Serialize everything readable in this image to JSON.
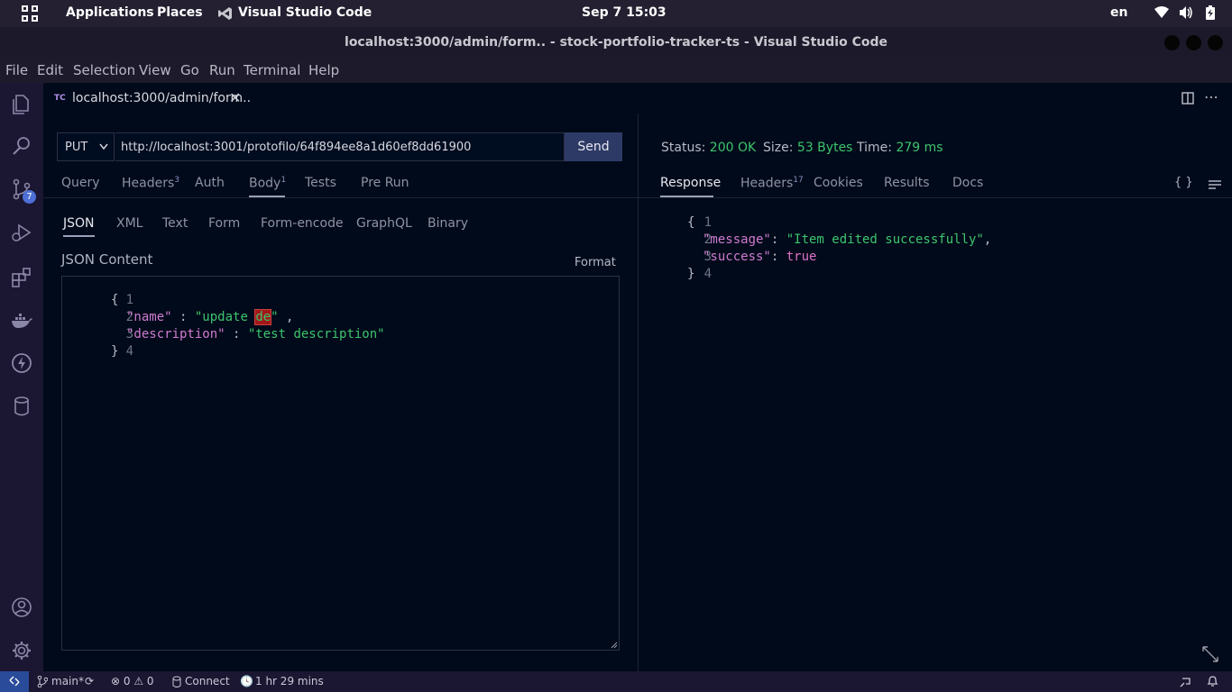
{
  "topbar": {
    "applications": "Applications",
    "places": "Places",
    "app_name": "Visual Studio Code",
    "datetime": "Sep 7  15:03",
    "lang": "en"
  },
  "window": {
    "title": "localhost:3000/admin/form.. - stock-portfolio-tracker-ts - Visual Studio Code"
  },
  "menu": [
    "File",
    "Edit",
    "Selection",
    "View",
    "Go",
    "Run",
    "Terminal",
    "Help"
  ],
  "activity": {
    "source_control_badge": "7"
  },
  "tab": {
    "icon_text": "TC",
    "label": "localhost:3000/admin/form.."
  },
  "request": {
    "method": "PUT",
    "url": "http://localhost:3001/protofilo/64f894ee8a1d60ef8dd61900",
    "send": "Send",
    "tabs": {
      "query": "Query",
      "headers": "Headers",
      "headers_count": "3",
      "auth": "Auth",
      "body": "Body",
      "body_count": "1",
      "tests": "Tests",
      "prerun": "Pre Run"
    },
    "body_types": [
      "JSON",
      "XML",
      "Text",
      "Form",
      "Form-encode",
      "GraphQL",
      "Binary"
    ],
    "content_label": "JSON Content",
    "format": "Format",
    "code": {
      "l1": "1",
      "l2": "2",
      "l3": "3",
      "l4": "4",
      "open": "{",
      "name_key": "\"name\"",
      "colon1": " : ",
      "name_val_a": "\"update ",
      "name_val_b": "de",
      "name_val_c": "\"",
      "comma1": " ,",
      "desc_key": "\"description\"",
      "colon2": " : ",
      "desc_val": "\"test description\"",
      "close": "}"
    }
  },
  "response": {
    "status_label": "Status:",
    "status_value": "200 OK",
    "size_label": "Size:",
    "size_value": "53 Bytes",
    "time_label": "Time:",
    "time_value": "279 ms",
    "tabs": {
      "response": "Response",
      "headers": "Headers",
      "headers_count": "17",
      "cookies": "Cookies",
      "results": "Results",
      "docs": "Docs",
      "braces": "{ }"
    },
    "code": {
      "l1": "1",
      "l2": "2",
      "l3": "3",
      "l4": "4",
      "open": "{",
      "msg_key": "\"message\"",
      "msg_val": "\"Item edited successfully\"",
      "succ_key": "\"success\"",
      "succ_val": "true",
      "close": "}"
    }
  },
  "statusbar": {
    "branch": "main*",
    "errors": "0",
    "warnings": "0",
    "connect": "Connect",
    "time": "1 hr 29 mins"
  },
  "colors": {
    "accent_green": "#3ec46d",
    "send_bg": "#2e3a66",
    "activity_bg": "#1b1632",
    "editor_bg": "#000a1a"
  }
}
